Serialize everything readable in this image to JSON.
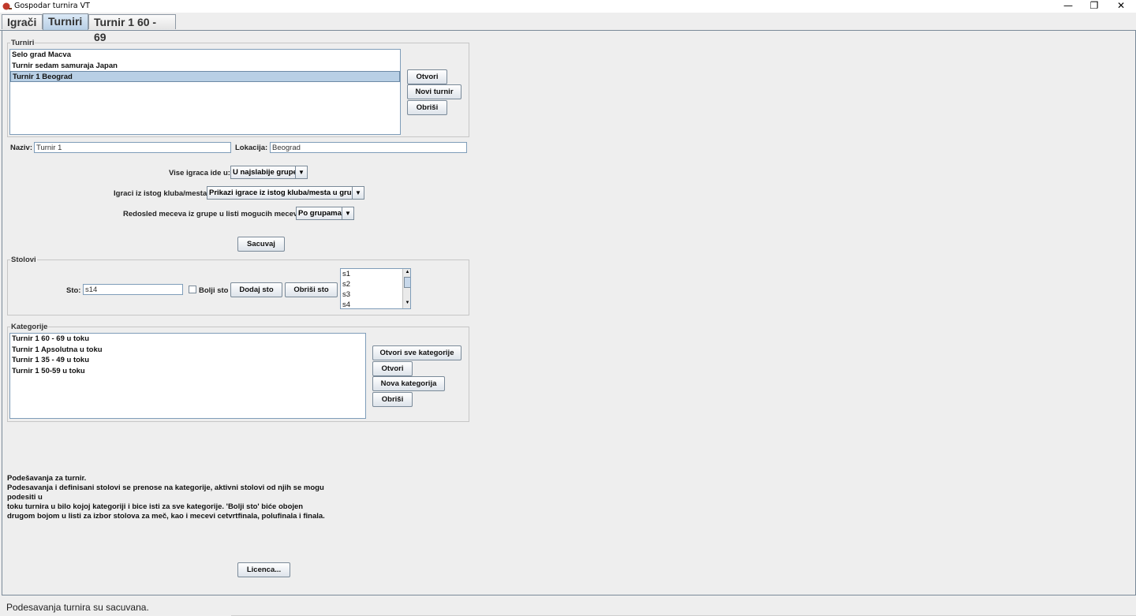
{
  "window": {
    "title": "Gospodar turnira VT",
    "minimize": "—",
    "maximize": "❐",
    "close": "✕"
  },
  "tabs": [
    {
      "label": "Igrači"
    },
    {
      "label": "Turniri"
    },
    {
      "label": "Turnir 1 60 - 69"
    }
  ],
  "tournaments": {
    "legend": "Turniri",
    "items": [
      "Selo grad Macva",
      "Turnir sedam samuraja Japan",
      "Turnir 1 Beograd"
    ],
    "selected_index": 2,
    "open_label": "Otvori",
    "new_label": "Novi turnir",
    "delete_label": "Obriši"
  },
  "details": {
    "name_label": "Naziv:",
    "name_value": "Turnir 1",
    "location_label": "Lokacija:",
    "location_value": "Beograd"
  },
  "settings": {
    "extra_players_label": "Vise igraca ide u:",
    "extra_players_value": "U najslabije grupe",
    "same_club_label": "Igraci iz istog kluba/mesta:",
    "same_club_value": "Prikazi igrace iz istog kluba/mesta u grupi",
    "match_order_label": "Redosled meceva iz grupe u listi mogucih meceva:",
    "match_order_value": "Po grupama",
    "save_label": "Sacuvaj"
  },
  "tables": {
    "legend": "Stolovi",
    "table_label": "Sto:",
    "table_value": "s14",
    "better_table_label": "Bolji sto",
    "better_table_checked": false,
    "add_label": "Dodaj sto",
    "delete_label": "Obriši sto",
    "items": [
      "s1",
      "s2",
      "s3",
      "s4"
    ]
  },
  "categories": {
    "legend": "Kategorije",
    "items": [
      "Turnir 1 60 - 69 u toku",
      "Turnir 1 Apsolutna u toku",
      "Turnir 1 35 - 49 u toku",
      "Turnir 1 50-59 u toku"
    ],
    "open_all_label": "Otvori sve kategorije",
    "open_label": "Otvori",
    "new_label": "Nova kategorija",
    "delete_label": "Obriši"
  },
  "info": {
    "line1": "Podešavanja za turnir.",
    "line2": "Podesavanja i definisani stolovi se prenose na kategorije, aktivni stolovi od njih se mogu podesiti u",
    "line3": "toku turnira u bilo kojoj kategoriji i bice isti za sve kategorije. 'Bolji sto' biće obojen",
    "line4": "drugom bojom u listi za izbor stolova za meč, kao i mecevi cetvrtfinala, polufinala i finala."
  },
  "license_label": "Licenca...",
  "status": "Podesavanja turnira su sacuvana.",
  "colors": {
    "selection": "#b8cfe5",
    "border": "#7a8a99",
    "background": "#eeeeee"
  }
}
